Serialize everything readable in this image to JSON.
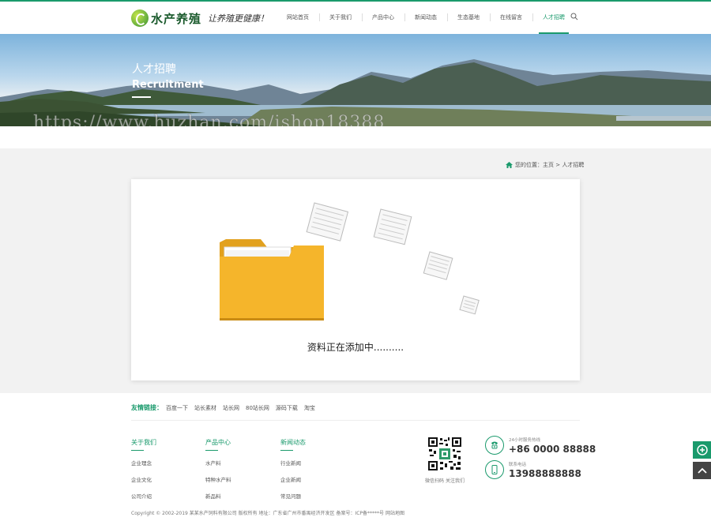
{
  "header": {
    "logo_name": "水产养殖",
    "logo_slogan": "让养殖更健康！",
    "nav": [
      {
        "label": "网站首页"
      },
      {
        "label": "关于我们"
      },
      {
        "label": "产品中心"
      },
      {
        "label": "新闻动态"
      },
      {
        "label": "生态基地"
      },
      {
        "label": "在线留言"
      },
      {
        "label": "人才招聘",
        "active": true
      }
    ],
    "search_icon": "search-icon"
  },
  "banner": {
    "title": "人才招聘",
    "subtitle": "Recruitment",
    "watermark": "https://www.huzhan.com/ishop18388"
  },
  "breadcrumb": {
    "icon": "home-icon",
    "text": "您的位置：主页 > 人才招聘"
  },
  "content": {
    "empty_message": "资料正在添加中..........",
    "illustration": "folder-icon"
  },
  "friend_links": {
    "label": "友情链接：",
    "items": [
      "百度一下",
      "站长素材",
      "站长网",
      "80站长网",
      "源码下载",
      "淘宝"
    ]
  },
  "footer": {
    "columns": [
      {
        "title": "关于我们",
        "links": [
          "企业理念",
          "企业文化",
          "公司介绍"
        ]
      },
      {
        "title": "产品中心",
        "links": [
          "水产料",
          "特种水产料",
          "新品料"
        ]
      },
      {
        "title": "新闻动态",
        "links": [
          "行业新闻",
          "企业新闻",
          "常见问题"
        ]
      }
    ],
    "qr_caption": "微信扫码 关注我们",
    "hotline_label": "24小时服务热线",
    "hotline": "+86 0000 88888",
    "mobile_label": "联系电话",
    "mobile": "13988888888",
    "copyright": "Copyright © 2002-2019 某某水产饲料有限公司 版权所有   地址：广东省广州市番禺经济开发区   备案号：ICP备*****号   网站地图"
  },
  "side_buttons": [
    "plus-circle-icon",
    "arrow-up-icon"
  ],
  "colors": {
    "accent": "#1a9a6c",
    "background": "#f2f2f2"
  }
}
